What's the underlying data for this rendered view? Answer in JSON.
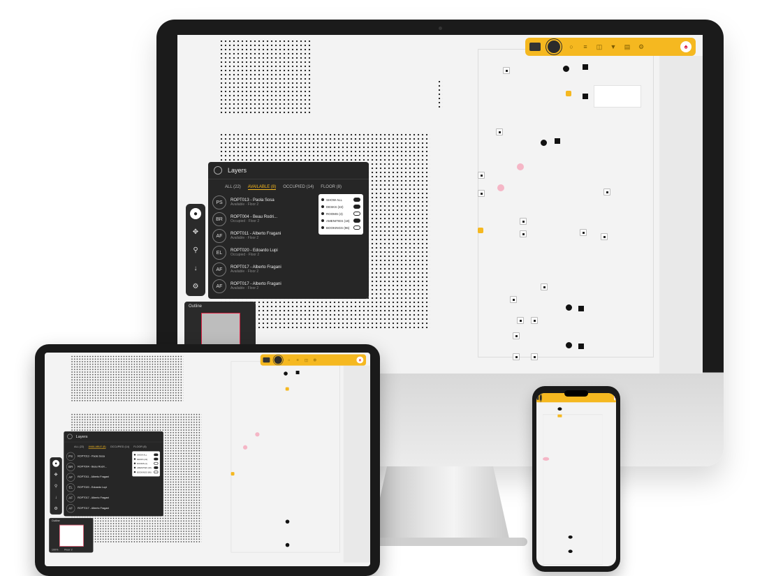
{
  "topbar": {
    "colors": {
      "accent": "#f5b820",
      "dark": "#262626",
      "highlight": "#d24266"
    },
    "icons": [
      "grid-icon",
      "logo-icon",
      "bell-icon",
      "list-icon",
      "map-icon",
      "filter-icon",
      "chart-icon",
      "settings-icon",
      "user-avatar-icon"
    ]
  },
  "panel": {
    "title": "Layers",
    "tabs": [
      "ALL (22)",
      "AVAILABLE (8)",
      "OCCUPIED (14)",
      "FLOOR (8)"
    ],
    "rows": [
      {
        "initials": "PS",
        "title": "ROPT013 - Paola Sosa",
        "subtitle": "Available · Floor 2"
      },
      {
        "initials": "BR",
        "title": "ROPT004 - Beau Rodri...",
        "subtitle": "Occupied · Floor 2"
      },
      {
        "initials": "AF",
        "title": "ROPT011 - Alberto Fragani",
        "subtitle": "Available · Floor 2"
      },
      {
        "initials": "EL",
        "title": "ROPT020 - Edoardo Lupi",
        "subtitle": "Occupied · Floor 2"
      },
      {
        "initials": "AF",
        "title": "ROPT017 - Alberto Fragani",
        "subtitle": "Available · Floor 2"
      },
      {
        "initials": "AF",
        "title": "ROPT017 - Alberto Fragani",
        "subtitle": "Available · Floor 2"
      }
    ],
    "filters": [
      {
        "label": "SHOW ALL",
        "on": true
      },
      {
        "label": "DESKS (22)",
        "on": true
      },
      {
        "label": "ROOMS (4)",
        "on": false
      },
      {
        "label": "AMENITIES (18)",
        "on": true
      },
      {
        "label": "BOOKINGS (96)",
        "on": false
      }
    ]
  },
  "outline": {
    "title": "Outline",
    "zoom_label": "100%",
    "floor_label": "Floor 2"
  }
}
